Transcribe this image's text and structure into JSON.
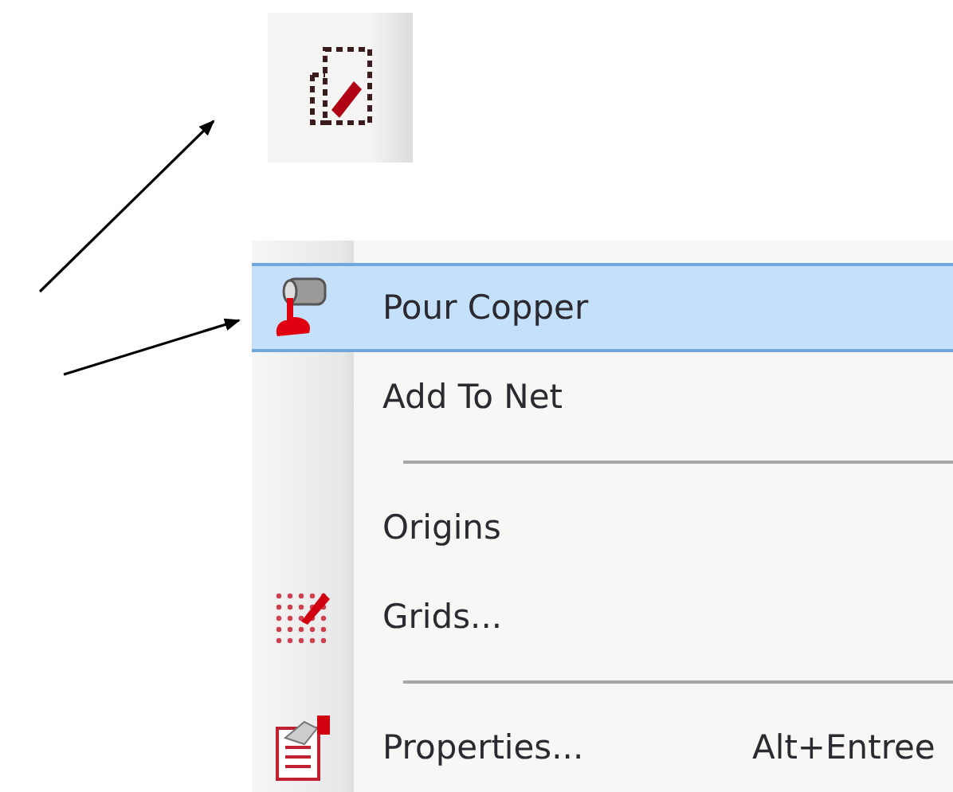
{
  "menu": {
    "items": [
      {
        "kind": "item",
        "label": "Pour Copper",
        "selected": true
      },
      {
        "kind": "item",
        "label": "Add To Net",
        "selected": false
      },
      {
        "kind": "separator"
      },
      {
        "kind": "item",
        "label": "Origins",
        "selected": false
      },
      {
        "kind": "item",
        "label": "Grids...",
        "selected": false
      },
      {
        "kind": "separator"
      },
      {
        "kind": "item",
        "label": "Properties...",
        "shortcut": "Alt+Entree",
        "selected": false
      }
    ]
  }
}
